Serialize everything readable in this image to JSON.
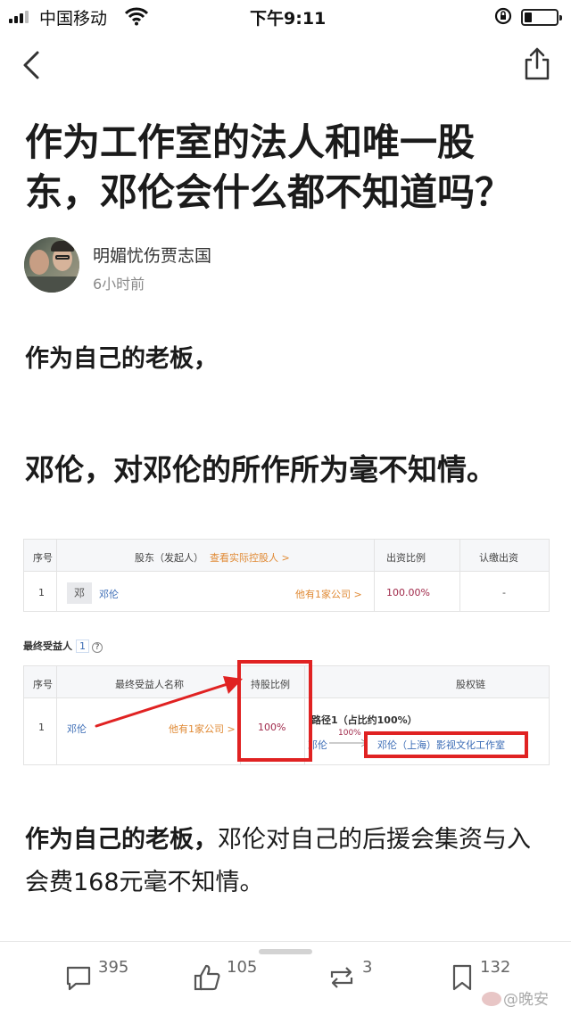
{
  "status_bar": {
    "carrier": "中国移动",
    "time": "下午9:11"
  },
  "article": {
    "title_line1": "作为工作室的法人和唯一股",
    "title_line2": "东，邓伦会什么都不知道吗？",
    "author": "明媚忧伤贾志国",
    "posted": "6小时前",
    "para1": "作为自己的老板，",
    "para2": "邓伦，对邓伦的所作所为毫不知情。",
    "para3_bold": "作为自己的老板，",
    "para3_rest": "邓伦对自己的后援会集资与入会费168元毫不知情。"
  },
  "embedded_image": {
    "shareholder_table": {
      "headers": [
        "序号",
        "股东（发起人）",
        "查看实际控股人 >",
        "出资比例",
        "认缴出资"
      ],
      "row": {
        "index": "1",
        "avatar_char": "邓",
        "name": "邓伦",
        "companies": "他有1家公司 >",
        "ratio": "100.00%",
        "subscribed": "-"
      }
    },
    "beneficiary_section": {
      "label": "最终受益人",
      "count": "1",
      "help_glyph": "?",
      "headers": [
        "序号",
        "最终受益人名称",
        "持股比例",
        "股权链"
      ],
      "row": {
        "index": "1",
        "name": "邓伦",
        "companies": "他有1家公司 >",
        "ratio": "100%",
        "path_title": "路径1（占比约100%）",
        "path_from": "邓伦",
        "path_pct": "100%",
        "path_to": "邓伦（上海）影视文化工作室"
      }
    },
    "annotation_color": "#e02222"
  },
  "action_bar": {
    "comments": "395",
    "likes": "105",
    "reposts": "3",
    "favorites": "132"
  },
  "watermark": "@晚安"
}
